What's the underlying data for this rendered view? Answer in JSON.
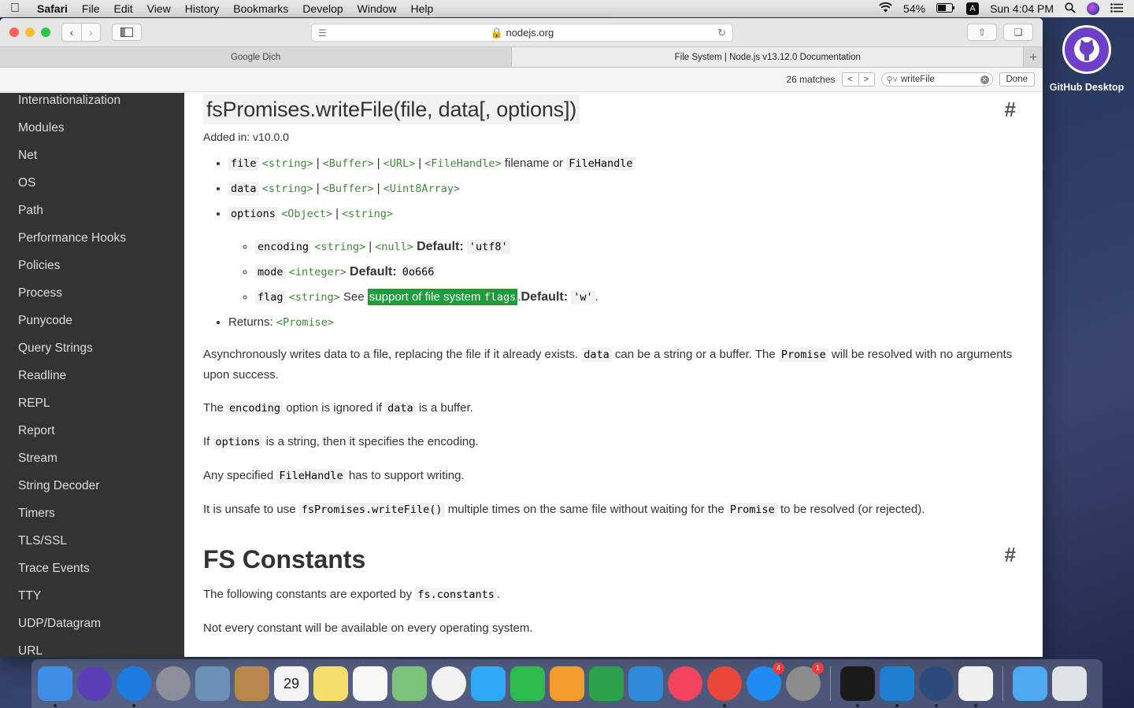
{
  "menubar": {
    "app_name": "Safari",
    "menus": [
      "File",
      "Edit",
      "View",
      "History",
      "Bookmarks",
      "Develop",
      "Window",
      "Help"
    ],
    "battery": "54%",
    "input_source": "A",
    "clock": "Sun 4:04 PM"
  },
  "browser": {
    "url": "nodejs.org",
    "tabs": [
      {
        "label": "Google Dịch",
        "active": false
      },
      {
        "label": "File System | Node.js v13.12.0 Documentation",
        "active": true
      }
    ],
    "find": {
      "matches": "26 matches",
      "query": "writeFile",
      "done_label": "Done"
    }
  },
  "sidebar": {
    "items": [
      "Internationalization",
      "Modules",
      "Net",
      "OS",
      "Path",
      "Performance Hooks",
      "Policies",
      "Process",
      "Punycode",
      "Query Strings",
      "Readline",
      "REPL",
      "Report",
      "Stream",
      "String Decoder",
      "Timers",
      "TLS/SSL",
      "Trace Events",
      "TTY",
      "UDP/Datagram",
      "URL"
    ]
  },
  "doc": {
    "heading": "fsPromises.writeFile(file, data[, options])",
    "hash": "#",
    "added_in": "Added in: v10.0.0",
    "params": {
      "file": {
        "name": "file",
        "types": [
          "<string>",
          "<Buffer>",
          "<URL>",
          "<FileHandle>"
        ],
        "desc": "filename or",
        "desc_code": "FileHandle"
      },
      "data": {
        "name": "data",
        "types": [
          "<string>",
          "<Buffer>",
          "<Uint8Array>"
        ]
      },
      "options": {
        "name": "options",
        "types": [
          "<Object>",
          "<string>"
        ]
      },
      "encoding": {
        "name": "encoding",
        "types": [
          "<string>",
          "<null>"
        ],
        "default_label": "Default:",
        "default": "'utf8'"
      },
      "mode": {
        "name": "mode",
        "types": [
          "<integer>"
        ],
        "default_label": "Default:",
        "default": "0o666"
      },
      "flag": {
        "name": "flag",
        "types": [
          "<string>"
        ],
        "see": "See",
        "link_text": "support of file system",
        "link_code": "flags",
        "default_label": "Default:",
        "default": "'w'"
      },
      "returns": {
        "label": "Returns:",
        "type": "<Promise>"
      }
    },
    "paragraphs": {
      "p1_a": "Asynchronously writes data to a file, replacing the file if it already exists.",
      "p1_code1": "data",
      "p1_b": "can be a string or a buffer. The",
      "p1_code2": "Promise",
      "p1_c": "will be resolved with no arguments upon success.",
      "p2_a": "The",
      "p2_code1": "encoding",
      "p2_b": "option is ignored if",
      "p2_code2": "data",
      "p2_c": "is a buffer.",
      "p3_a": "If",
      "p3_code": "options",
      "p3_b": "is a string, then it specifies the encoding.",
      "p4_a": "Any specified",
      "p4_code": "FileHandle",
      "p4_b": "has to support writing.",
      "p5_a": "It is unsafe to use",
      "p5_code1": "fsPromises.writeFile()",
      "p5_b": "multiple times on the same file without waiting for the",
      "p5_code2": "Promise",
      "p5_c": "to be resolved (or rejected)."
    },
    "section_heading": "FS Constants",
    "section_p1_a": "The following constants are exported by",
    "section_p1_code": "fs.constants",
    "section_p1_b": ".",
    "section_p2": "Not every constant will be available on every operating system."
  },
  "desktop": {
    "icon_label": "GitHub Desktop"
  },
  "dock": {
    "apps": [
      {
        "name": "finder",
        "color": "#3e8ee8",
        "dot": true
      },
      {
        "name": "siri",
        "color": "#5a3fb8",
        "dot": false
      },
      {
        "name": "safari",
        "color": "#1d7be0",
        "dot": true
      },
      {
        "name": "launchpad",
        "color": "#8a8f9a",
        "dot": false
      },
      {
        "name": "preview-eagle",
        "color": "#6d90b8",
        "dot": false
      },
      {
        "name": "contacts",
        "color": "#b9874c",
        "dot": false
      },
      {
        "name": "calendar",
        "color": "#f4f4f4",
        "dot": false,
        "label": "29"
      },
      {
        "name": "notes",
        "color": "#f6de6c",
        "dot": false
      },
      {
        "name": "reminders",
        "color": "#f7f7f7",
        "dot": false
      },
      {
        "name": "maps",
        "color": "#7cc27a",
        "dot": false
      },
      {
        "name": "photos",
        "color": "#f2f2f2",
        "dot": false
      },
      {
        "name": "messages",
        "color": "#2fa8f5",
        "dot": false
      },
      {
        "name": "facetime",
        "color": "#2dbb4e",
        "dot": false
      },
      {
        "name": "pages",
        "color": "#f39c2c",
        "dot": false
      },
      {
        "name": "numbers",
        "color": "#2ba34a",
        "dot": false
      },
      {
        "name": "keynote",
        "color": "#2f8ad9",
        "dot": false
      },
      {
        "name": "music",
        "color": "#f2445f",
        "dot": false
      },
      {
        "name": "chrome",
        "color": "#e9473a",
        "dot": true
      },
      {
        "name": "app-store",
        "color": "#1e8cf3",
        "dot": false,
        "badge": "4"
      },
      {
        "name": "system-preferences",
        "color": "#8c8c8c",
        "dot": false,
        "badge": "1"
      },
      {
        "name": "terminal",
        "color": "#1b1b1b",
        "dot": true
      },
      {
        "name": "vscode",
        "color": "#1f7fd3",
        "dot": true
      },
      {
        "name": "quicktime",
        "color": "#2c4b7a",
        "dot": true
      },
      {
        "name": "textedit",
        "color": "#efefef",
        "dot": true
      },
      {
        "name": "downloads-folder",
        "color": "#4fa9f0",
        "dot": false
      },
      {
        "name": "trash",
        "color": "#dfe3e8",
        "dot": false
      }
    ]
  }
}
